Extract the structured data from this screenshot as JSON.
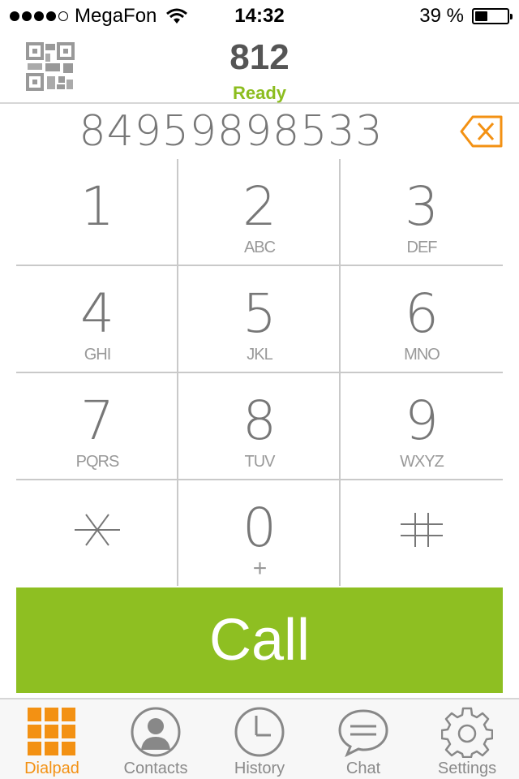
{
  "status_bar": {
    "carrier": "MegaFon",
    "time": "14:32",
    "battery": "39 %",
    "battery_level": 0.39,
    "signal_bars": 4,
    "signal_max": 5
  },
  "header": {
    "account_number": "812",
    "status": "Ready",
    "status_color": "#8cbd1f"
  },
  "dialer": {
    "number": "84959898533",
    "accent_color": "#f39113"
  },
  "keypad": {
    "keys": [
      {
        "digit": "1",
        "letters": ""
      },
      {
        "digit": "2",
        "letters": "ABC"
      },
      {
        "digit": "3",
        "letters": "DEF"
      },
      {
        "digit": "4",
        "letters": "GHI"
      },
      {
        "digit": "5",
        "letters": "JKL"
      },
      {
        "digit": "6",
        "letters": "MNO"
      },
      {
        "digit": "7",
        "letters": "PQRS"
      },
      {
        "digit": "8",
        "letters": "TUV"
      },
      {
        "digit": "9",
        "letters": "WXYZ"
      },
      {
        "digit": "*",
        "letters": ""
      },
      {
        "digit": "0",
        "letters": "+"
      },
      {
        "digit": "#",
        "letters": ""
      }
    ]
  },
  "call": {
    "label": "Call",
    "color": "#8ebf22"
  },
  "tabs": [
    {
      "label": "Dialpad",
      "icon": "dialpad-icon",
      "active": true
    },
    {
      "label": "Contacts",
      "icon": "contacts-icon",
      "active": false
    },
    {
      "label": "History",
      "icon": "history-icon",
      "active": false
    },
    {
      "label": "Chat",
      "icon": "chat-icon",
      "active": false
    },
    {
      "label": "Settings",
      "icon": "settings-icon",
      "active": false
    }
  ]
}
